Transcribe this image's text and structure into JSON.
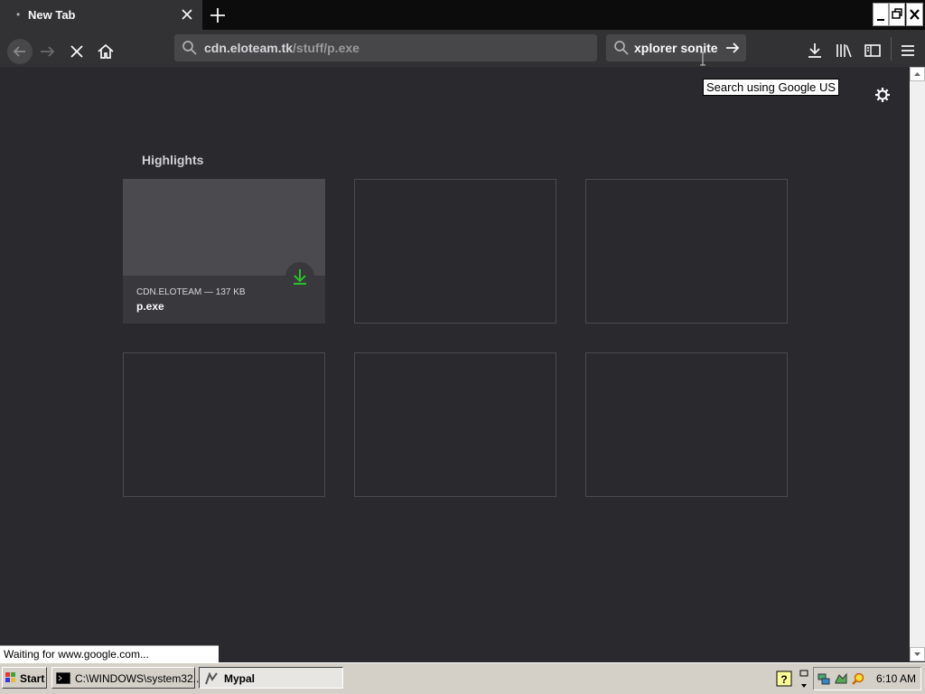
{
  "browser": {
    "tab_title": "New Tab",
    "tab_dot": "•",
    "url_host": "cdn.eloteam.tk",
    "url_path": "/stuff/p.exe",
    "search_text": "xplorer sonite",
    "tooltip": "Search using Google US",
    "status": "Waiting for www.google.com..."
  },
  "highlights": {
    "heading": "Highlights",
    "cards": [
      {
        "source": "CDN.ELOTEAM — 137 KB",
        "title": "p.exe"
      }
    ]
  },
  "taskbar": {
    "start_label": "Start",
    "tasks": [
      {
        "label": "C:\\WINDOWS\\system32..."
      },
      {
        "label": "Mypal"
      }
    ],
    "clock": "6:10 AM"
  },
  "colors": {
    "download_green": "#2ac12a",
    "background": "#2a2a2e"
  }
}
